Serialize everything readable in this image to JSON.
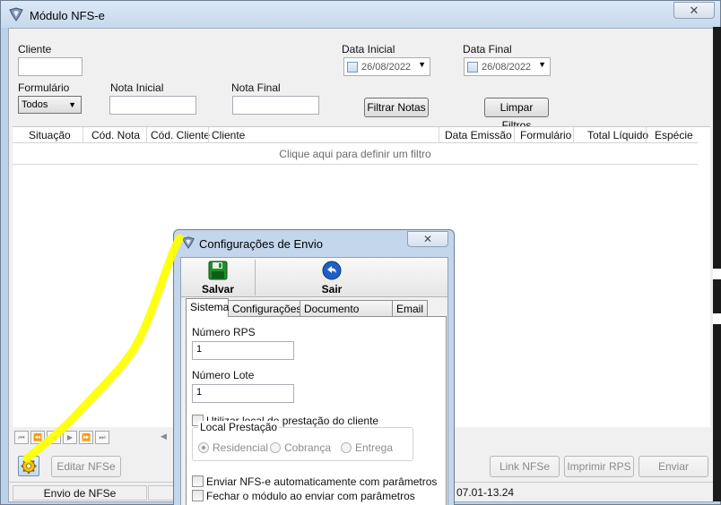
{
  "window": {
    "title": "Módulo NFS-e",
    "close_glyph": "✕"
  },
  "filters": {
    "cliente_label": "Cliente",
    "cliente_value": "",
    "data_inicial_label": "Data Inicial",
    "data_inicial_value": "26/08/2022",
    "data_final_label": "Data Final",
    "data_final_value": "26/08/2022",
    "formulario_label": "Formulário",
    "formulario_value": "Todos",
    "nota_inicial_label": "Nota Inicial",
    "nota_inicial_value": "",
    "nota_final_label": "Nota Final",
    "nota_final_value": "",
    "filtrar_label": "Filtrar Notas",
    "limpar_label": "Limpar Filtros"
  },
  "grid": {
    "columns": [
      "Situação",
      "Cód. Nota",
      "Cód. Cliente",
      "Cliente",
      "Data Emissão",
      "Formulário",
      "Total Líquido",
      "Espécie"
    ],
    "filter_hint": "Clique aqui para definir um filtro"
  },
  "footer": {
    "editar_label": "Editar NFSe",
    "link_label": "Link NFSe",
    "imprimir_label": "Imprimir RPS",
    "enviar_label": "Enviar",
    "status_left": "Envio de NFSe",
    "status_right": "07.01-13.24"
  },
  "dialog": {
    "title": "Configurações de Envio",
    "close_glyph": "✕",
    "salvar_label": "Salvar",
    "sair_label": "Sair",
    "tabs": [
      "Sistema",
      "Configurações",
      "Documento Auxiliar",
      "Email"
    ],
    "active_tab": "Sistema",
    "numero_rps_label": "Número RPS",
    "numero_rps_value": "1",
    "numero_lote_label": "Número Lote",
    "numero_lote_value": "1",
    "utilizar_local_label": "Utilizar local de prestação do cliente",
    "local_group_label": "Local Prestação",
    "radio_residencial": "Residencial",
    "radio_cobranca": "Cobrança",
    "radio_entrega": "Entrega",
    "enviar_auto_label": "Enviar NFS-e automaticamente com parâmetros",
    "fechar_label": "Fechar o módulo ao enviar com parâmetros"
  },
  "colors": {
    "annotation": "#ffff00",
    "accent_save": "#1f8f2a",
    "accent_exit": "#1d5fc4"
  }
}
